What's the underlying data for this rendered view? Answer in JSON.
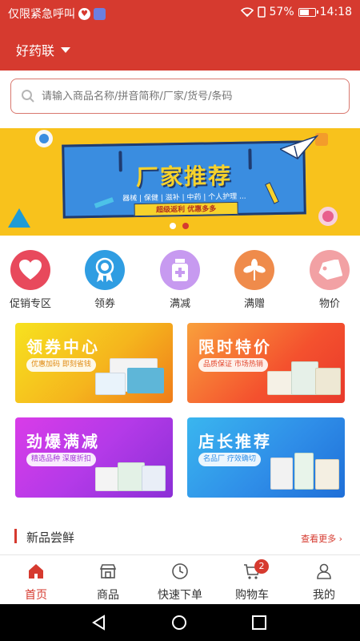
{
  "status_bar": {
    "carrier": "仅限紧急呼叫",
    "battery": "57%",
    "time": "14:18"
  },
  "header": {
    "store_name": "好药联"
  },
  "search": {
    "placeholder": "请输入商品名称/拼音简称/厂家/货号/条码"
  },
  "banner": {
    "title": "厂家推荐",
    "subtitle": "器械 | 保健 | 滋补 | 中药 | 个人护理 ...",
    "tag": "超级返利   优惠多多",
    "slides": 2,
    "active_slide": 1
  },
  "categories": [
    {
      "label": "促销专区",
      "icon": "heart-icon",
      "color": "#e8495c"
    },
    {
      "label": "领券",
      "icon": "ribbon-badge-icon",
      "color": "#2f9de2"
    },
    {
      "label": "满减",
      "icon": "medicine-bottle-icon",
      "color": "#c79af0"
    },
    {
      "label": "满赠",
      "icon": "leaf-icon",
      "color": "#ef8b4b"
    },
    {
      "label": "物价",
      "icon": "price-tag-icon",
      "color": "#f2a1a4"
    }
  ],
  "promo_cards": [
    {
      "title": "领券中心",
      "subtitle": "优惠加码 即刻省钱",
      "accent": "#f5b51d"
    },
    {
      "title": "限时特价",
      "subtitle": "品质保证 市场热销",
      "accent": "#f4512e"
    },
    {
      "title": "劲爆满减",
      "subtitle": "精选品种 深度折扣",
      "accent": "#b43ae8"
    },
    {
      "title": "店长推荐",
      "subtitle": "名品厂 疗效确切",
      "accent": "#2f8ee8"
    }
  ],
  "section": {
    "title": "新品尝鲜",
    "more": "查看更多"
  },
  "tabbar": {
    "items": [
      {
        "label": "首页",
        "icon": "home-icon"
      },
      {
        "label": "商品",
        "icon": "store-icon"
      },
      {
        "label": "快速下单",
        "icon": "clock-icon"
      },
      {
        "label": "购物车",
        "icon": "cart-icon"
      },
      {
        "label": "我的",
        "icon": "user-icon"
      }
    ],
    "active": "首页",
    "cart_badge": "2"
  },
  "colors": {
    "brand": "#d63a2f"
  }
}
